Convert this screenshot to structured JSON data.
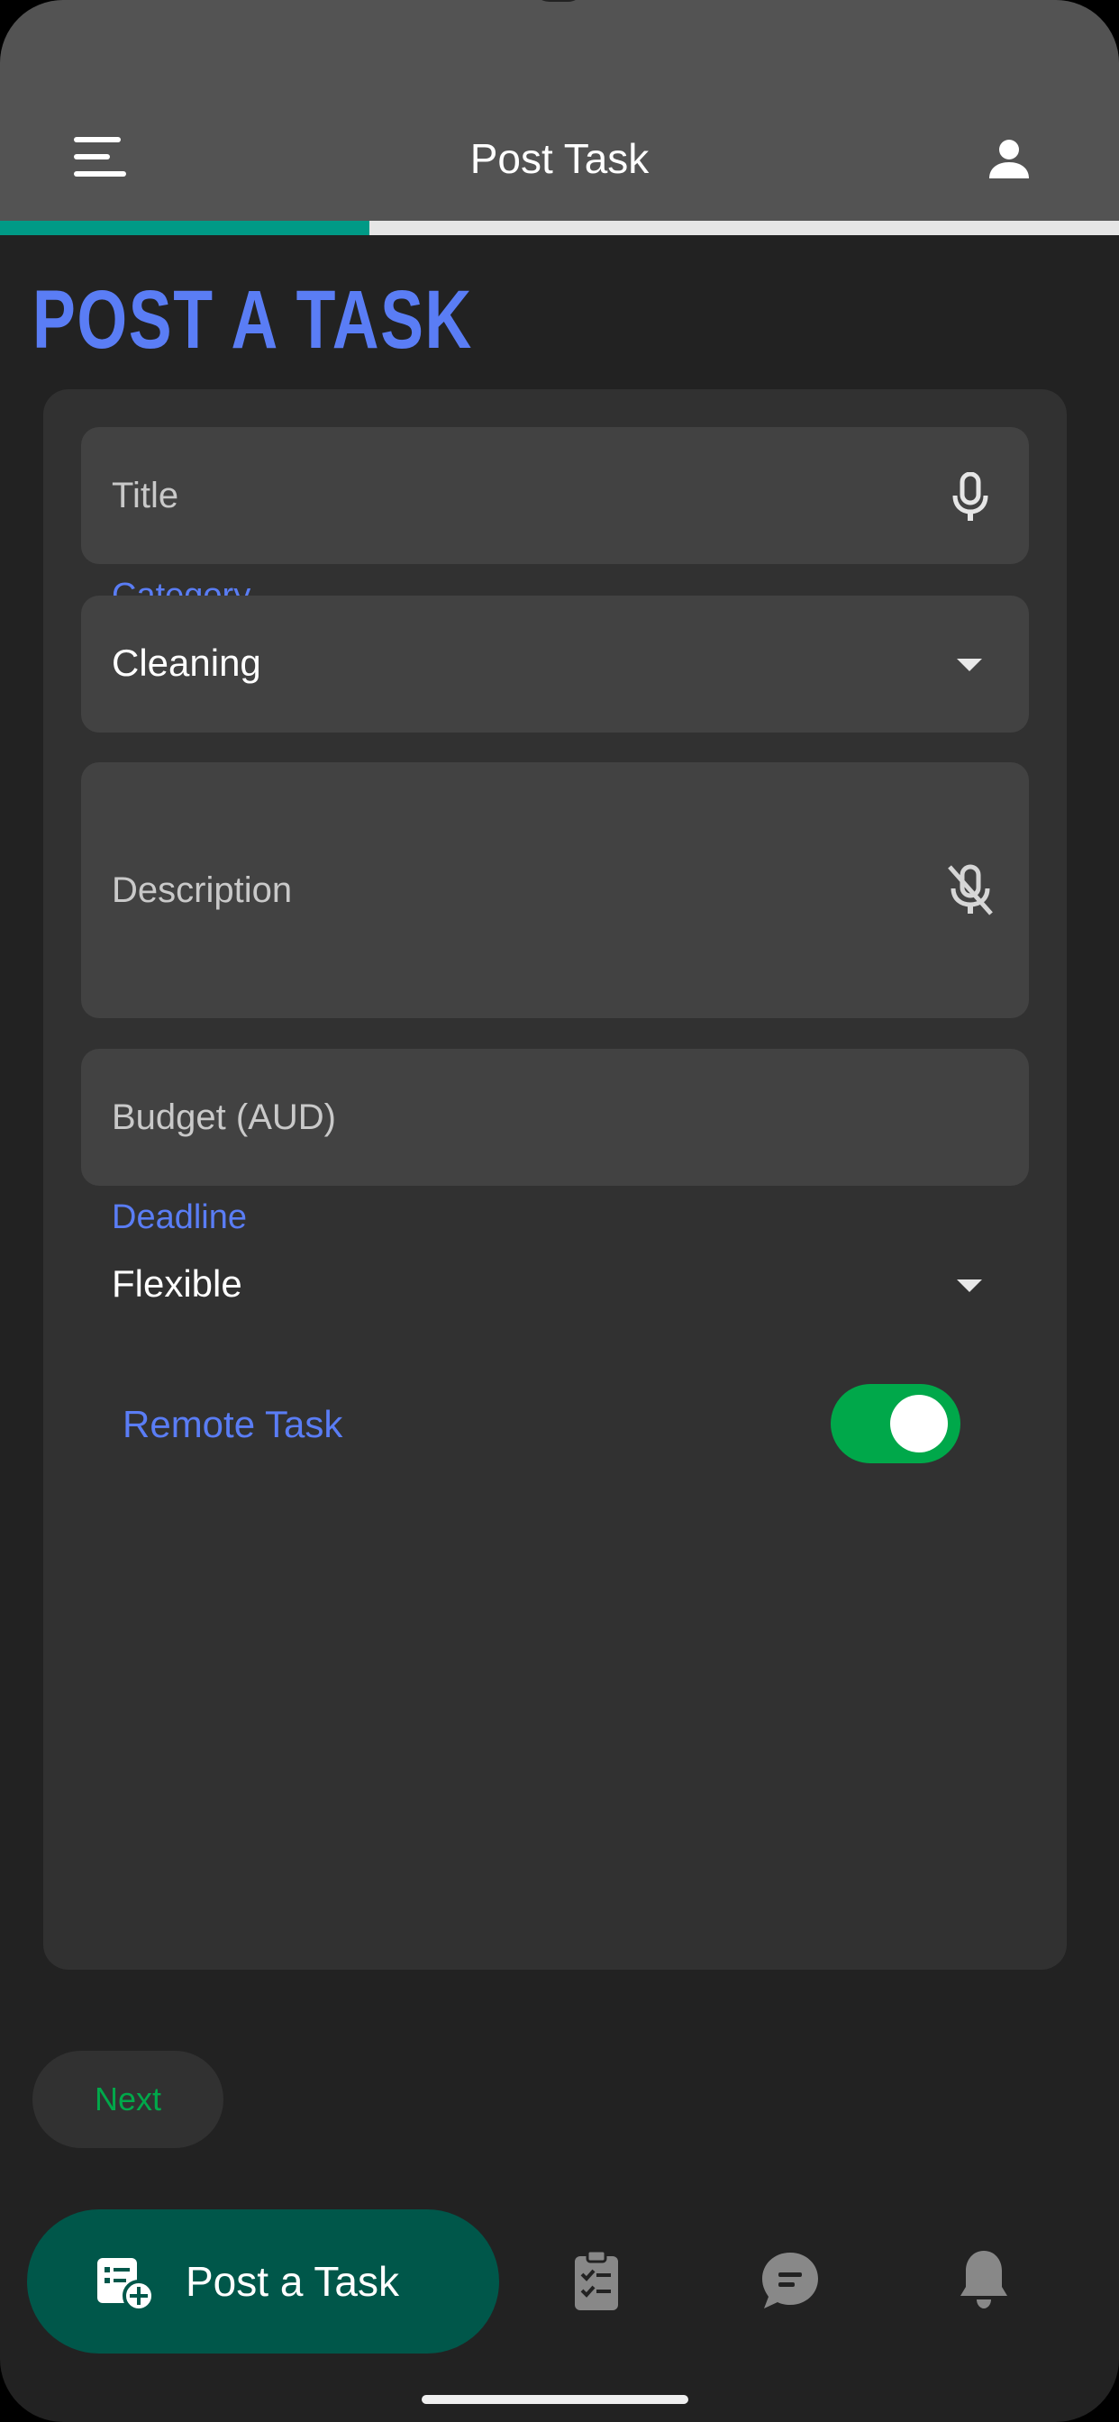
{
  "app_bar": {
    "title": "Post Task",
    "menu_icon": "menu-icon",
    "profile_icon": "person-icon",
    "progress_fraction": 0.33,
    "progress_color": "#009a86"
  },
  "page": {
    "heading": "POST A TASK",
    "heading_color": "#5a7df5"
  },
  "form": {
    "title": {
      "placeholder": "Title",
      "icon": "microphone-icon"
    },
    "category": {
      "label": "Category",
      "value": "Cleaning"
    },
    "description": {
      "placeholder": "Description",
      "icon": "microphone-off-icon"
    },
    "budget": {
      "placeholder": "Budget (AUD)"
    },
    "deadline": {
      "label": "Deadline",
      "value": "Flexible"
    },
    "remote_task": {
      "label": "Remote Task",
      "enabled": true,
      "toggle_color": "#00a84a"
    }
  },
  "actions": {
    "next_label": "Next"
  },
  "bottom_nav": {
    "primary_label": "Post a Task",
    "primary_icon": "post-task-icon",
    "items": [
      {
        "icon": "clipboard-checklist-icon"
      },
      {
        "icon": "chat-bubble-icon"
      },
      {
        "icon": "bell-icon"
      }
    ]
  }
}
